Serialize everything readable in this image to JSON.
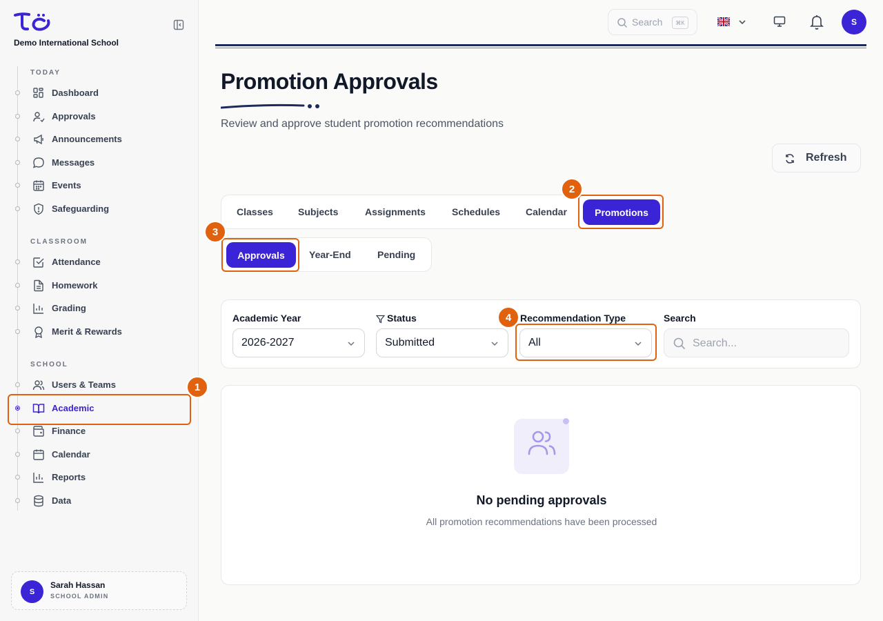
{
  "sidebar": {
    "school_name": "Demo International School",
    "sections": {
      "today": "TODAY",
      "classroom": "CLASSROOM",
      "school": "SCHOOL"
    },
    "items": {
      "dashboard": "Dashboard",
      "approvals": "Approvals",
      "announcements": "Announcements",
      "messages": "Messages",
      "events": "Events",
      "safeguarding": "Safeguarding",
      "attendance": "Attendance",
      "homework": "Homework",
      "grading": "Grading",
      "merit": "Merit & Rewards",
      "users": "Users & Teams",
      "academic": "Academic",
      "finance": "Finance",
      "calendar": "Calendar",
      "reports": "Reports",
      "data": "Data"
    },
    "active_item": "Academic",
    "user": {
      "initial": "S",
      "name": "Sarah Hassan",
      "role": "SCHOOL ADMIN"
    }
  },
  "topbar": {
    "search_placeholder": "Search",
    "search_shortcut": "⌘K",
    "language_flag": "uk-flag",
    "avatar_initial": "S"
  },
  "page": {
    "title": "Promotion Approvals",
    "subtitle": "Review and approve student promotion recommendations",
    "refresh_label": "Refresh"
  },
  "tabs": {
    "items": [
      "Classes",
      "Subjects",
      "Assignments",
      "Schedules",
      "Calendar",
      "Promotions"
    ],
    "active": "Promotions"
  },
  "subtabs": {
    "items": [
      "Approvals",
      "Year-End",
      "Pending"
    ],
    "active": "Approvals"
  },
  "filters": {
    "academic_year": {
      "label": "Academic Year",
      "value": "2026-2027"
    },
    "status": {
      "label": "Status",
      "value": "Submitted"
    },
    "recommendation_type": {
      "label": "Recommendation Type",
      "value": "All"
    },
    "search": {
      "label": "Search",
      "placeholder": "Search..."
    }
  },
  "empty_state": {
    "title": "No pending approvals",
    "message": "All promotion recommendations have been processed"
  },
  "annotations": [
    "1",
    "2",
    "3",
    "4"
  ],
  "colors": {
    "accent": "#3b23d6",
    "annotation": "#e0620e",
    "navy_rule": "#1e2a5a"
  }
}
